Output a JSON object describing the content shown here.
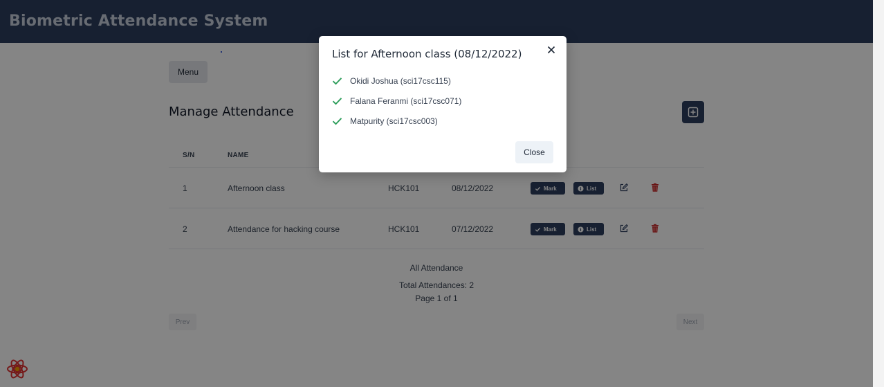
{
  "header": {
    "title": "Biometric Attendance System"
  },
  "toolbar": {
    "menu_label": "Menu"
  },
  "page": {
    "title": "Manage Attendance"
  },
  "table": {
    "columns": [
      "S/N",
      "NAME"
    ],
    "rows": [
      {
        "sn": "1",
        "name": "Afternoon class",
        "code": "HCK101",
        "date": "08/12/2022",
        "mark_label": "Mark",
        "list_label": "List"
      },
      {
        "sn": "2",
        "name": "Attendance for hacking course",
        "code": "HCK101",
        "date": "07/12/2022",
        "mark_label": "Mark",
        "list_label": "List"
      }
    ]
  },
  "summary": {
    "heading": "All Attendance",
    "total": "Total Attendances: 2",
    "page": "Page 1 of 1"
  },
  "pagination": {
    "prev": "Prev",
    "next": "Next"
  },
  "modal": {
    "title": "List for Afternoon class (08/12/2022)",
    "entries": [
      "Okidi Joshua (sci17csc115)",
      "Falana Feranmi (sci17csc071)",
      "Matpurity (sci17csc003)"
    ],
    "close_label": "Close"
  },
  "colors": {
    "header_bg": "#2c3e5f",
    "accent": "#2c3e5f",
    "check": "#2f9e5c",
    "delete": "#c92a2a",
    "overlay": "rgba(0,0,0,0.48)"
  },
  "icons": [
    "add-icon",
    "check-icon",
    "info-icon",
    "edit-icon",
    "trash-icon",
    "close-icon",
    "react-icon"
  ]
}
